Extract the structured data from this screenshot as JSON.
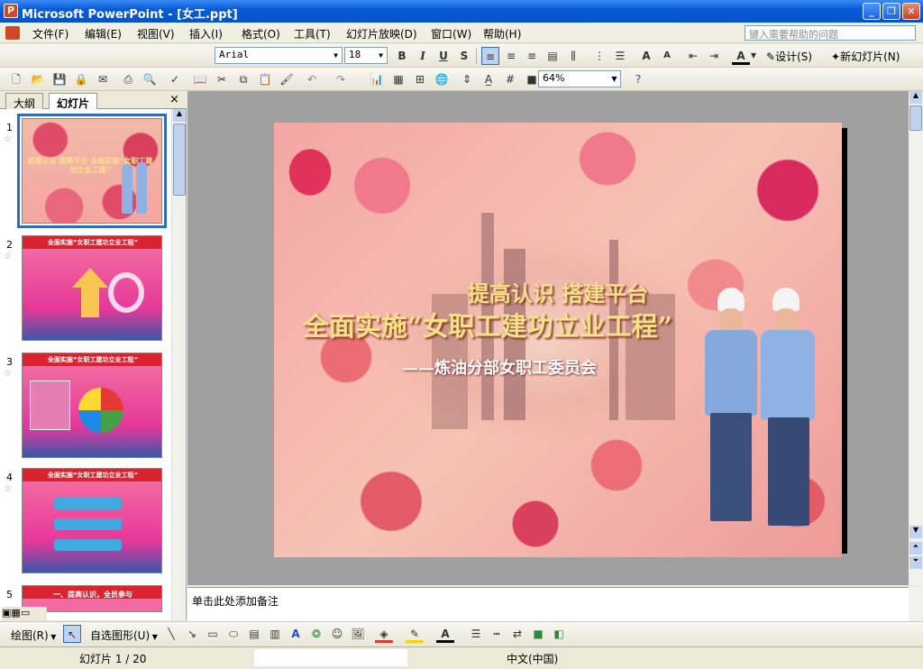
{
  "window": {
    "title": "Microsoft PowerPoint - [女工.ppt]",
    "app_icon": "P"
  },
  "menu": {
    "items": [
      "文件(F)",
      "编辑(E)",
      "视图(V)",
      "插入(I)",
      "格式(O)",
      "工具(T)",
      "幻灯片放映(D)",
      "窗口(W)",
      "帮助(H)"
    ],
    "help_placeholder": "键入需要帮助的问题"
  },
  "format_toolbar": {
    "font": "Arial",
    "size": "18",
    "bold": "B",
    "italic": "I",
    "underline": "U",
    "shadow": "S",
    "design_label": "设计(S)",
    "new_slide_label": "新幻灯片(N)"
  },
  "standard_toolbar": {
    "zoom": "64%"
  },
  "panel": {
    "tab_outline": "大纲",
    "tab_slides": "幻灯片",
    "close": "×"
  },
  "thumbnails": [
    {
      "num": "1",
      "title": "提高认识 搭建平台 全面实施“女职工建功立业工程”"
    },
    {
      "num": "2",
      "title": "全面实施“女职工建功立业工程”"
    },
    {
      "num": "3",
      "title": "全面实施“女职工建功立业工程”"
    },
    {
      "num": "4",
      "title": "全面实施“女职工建功立业工程”"
    },
    {
      "num": "5",
      "title": "一、提高认识，全员参与"
    }
  ],
  "slide": {
    "line1": "提高认识  搭建平台",
    "line2": "全面实施“女职工建功立业工程”",
    "line3": "——炼油分部女职工委员会"
  },
  "notes": {
    "placeholder": "单击此处添加备注"
  },
  "draw_toolbar": {
    "draw_label": "绘图(R)",
    "autoshapes_label": "自选图形(U)"
  },
  "status": {
    "slide_info": "幻灯片 1 / 20",
    "language": "中文(中国)"
  },
  "colors": {
    "title_blue": "#0a5bd8",
    "slide_title_gold": "#f7e08a",
    "slide_bg_pink": "#e58a8f"
  }
}
